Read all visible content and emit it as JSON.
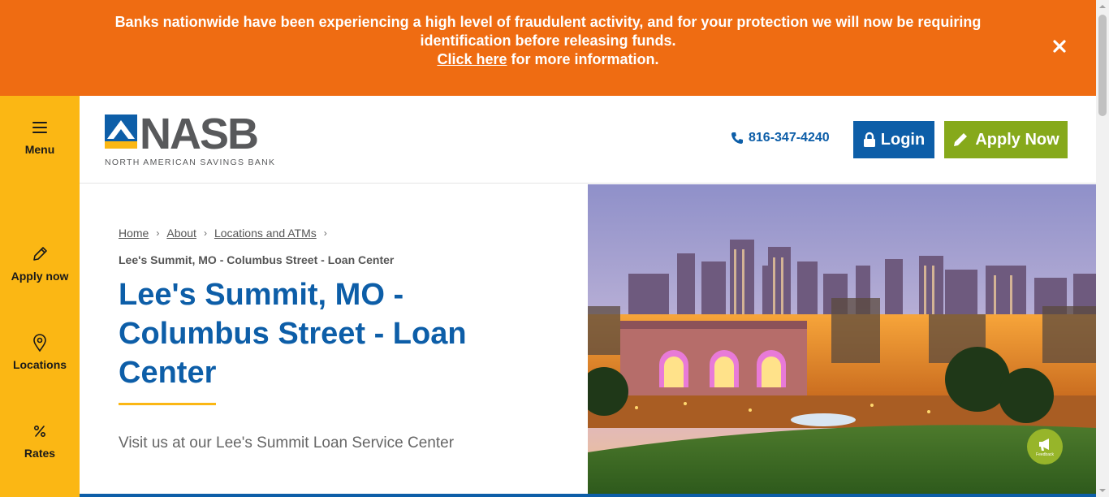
{
  "alert": {
    "line1": "Banks nationwide have been experiencing a high level of fraudulent activity, and for your protection we will now be requiring",
    "line2": "identification before releasing funds.",
    "link": "Click here",
    "line3_rest": " for more information.",
    "close_icon": "close-icon"
  },
  "side_nav": {
    "items": [
      {
        "label": "Menu",
        "icon": "menu-icon"
      },
      {
        "label": "Apply now",
        "icon": "pencil-icon"
      },
      {
        "label": "Locations",
        "icon": "map-pin-icon"
      },
      {
        "label": "Rates",
        "icon": "percent-icon"
      }
    ]
  },
  "header": {
    "logo_text": "NASB",
    "logo_sub": "NORTH AMERICAN SAVINGS BANK",
    "phone": "816-347-4240",
    "login_label": "Login",
    "apply_label": "Apply Now"
  },
  "breadcrumb": {
    "items": [
      "Home",
      "About",
      "Locations and ATMs"
    ],
    "current": "Lee's Summit, MO - Columbus Street - Loan Center"
  },
  "page": {
    "title": "Lee's Summit, MO - Columbus Street - Loan Center",
    "subtitle": "Visit us at our Lee's Summit Loan Service Center"
  },
  "feedback": {
    "label": "Feedback"
  },
  "colors": {
    "alert_bg": "#ef6c12",
    "side_bg": "#fbb714",
    "brand_blue": "#0d5ea8",
    "apply_green": "#86a91b"
  }
}
